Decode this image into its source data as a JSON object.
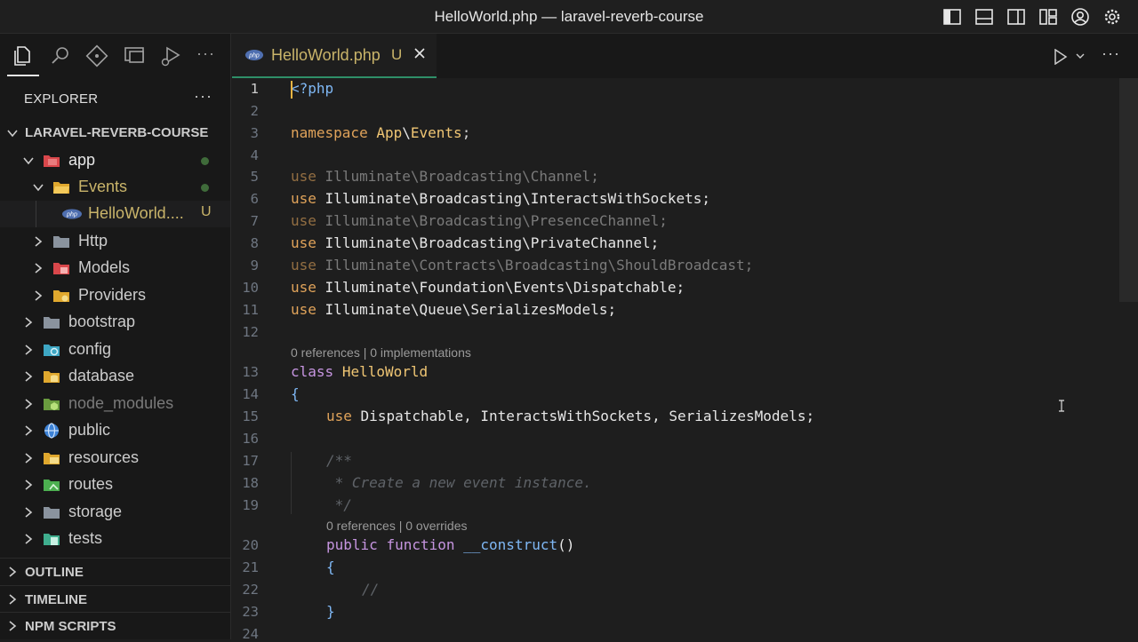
{
  "window": {
    "title": "HelloWorld.php — laravel-reverb-course"
  },
  "titlebar_icons": [
    "toggle-primary-sidebar-icon",
    "toggle-panel-icon",
    "toggle-secondary-sidebar-icon",
    "customize-layout-icon",
    "accounts-icon",
    "settings-gear-icon"
  ],
  "activity_bar": [
    "explorer-icon",
    "search-icon",
    "source-control-icon",
    "remote-explorer-icon",
    "run-debug-icon",
    "more-icon"
  ],
  "explorer": {
    "header": "EXPLORER",
    "more": "···",
    "root": "LARAVEL-REVERB-COURSE",
    "items": [
      {
        "label": "app",
        "color": "#e8e8e8",
        "badge": "dot"
      },
      {
        "label": "Events",
        "color": "#c9b46a",
        "badge": "dot"
      },
      {
        "label": "HelloWorld....",
        "color": "#c9b46a",
        "badge": "U"
      },
      {
        "label": "Http"
      },
      {
        "label": "Models"
      },
      {
        "label": "Providers"
      },
      {
        "label": "bootstrap"
      },
      {
        "label": "config"
      },
      {
        "label": "database"
      },
      {
        "label": "node_modules",
        "color": "#7a7a7a"
      },
      {
        "label": "public"
      },
      {
        "label": "resources"
      },
      {
        "label": "routes"
      },
      {
        "label": "storage"
      },
      {
        "label": "tests"
      }
    ],
    "sections": [
      "OUTLINE",
      "TIMELINE",
      "NPM SCRIPTS"
    ]
  },
  "editor": {
    "tab": {
      "label": "HelloWorld.php",
      "status": "U"
    },
    "more": "···",
    "line_numbers": [
      "1",
      "2",
      "3",
      "4",
      "5",
      "6",
      "7",
      "8",
      "9",
      "10",
      "11",
      "12",
      "13",
      "14",
      "15",
      "16",
      "17",
      "18",
      "19",
      "20",
      "21",
      "22",
      "23",
      "24"
    ],
    "codelens": {
      "class": "0 references | 0 implementations",
      "constructor": "0 references | 0 overrides"
    },
    "code": {
      "l1": "<?php",
      "l3_kw": "namespace",
      "l3_ns": "App",
      "l3_cls": "Events",
      "l3_end": ";",
      "uses": [
        {
          "kw": "use",
          "a": "Illuminate",
          "b": "Broadcasting",
          "c": "Channel",
          "end": ";"
        },
        {
          "kw": "use",
          "a": "Illuminate",
          "b": "Broadcasting",
          "c": "InteractsWithSockets",
          "end": ";"
        },
        {
          "kw": "use",
          "a": "Illuminate",
          "b": "Broadcasting",
          "c": "PresenceChannel",
          "end": ";"
        },
        {
          "kw": "use",
          "a": "Illuminate",
          "b": "Broadcasting",
          "c": "PrivateChannel",
          "end": ";"
        },
        {
          "kw": "use",
          "a": "Illuminate",
          "b": "Contracts",
          "b2": "Broadcasting",
          "c": "ShouldBroadcast",
          "end": ";"
        },
        {
          "kw": "use",
          "a": "Illuminate",
          "b": "Foundation",
          "b2": "Events",
          "c": "Dispatchable",
          "end": ";"
        },
        {
          "kw": "use",
          "a": "Illuminate",
          "b": "Queue",
          "c": "SerializesModels",
          "end": ";"
        }
      ],
      "l13_kw": "class",
      "l13_name": "HelloWorld",
      "l14": "{",
      "l15_kw": "use",
      "l15_rest": "Dispatchable, InteractsWithSockets, SerializesModels;",
      "l17": "/**",
      "l18": " * Create a new event instance.",
      "l19": " */",
      "l20_kw1": "public",
      "l20_kw2": "function",
      "l20_fn": "__construct",
      "l20_paren": "()",
      "l21": "{",
      "l22": "//",
      "l23": "}"
    }
  }
}
